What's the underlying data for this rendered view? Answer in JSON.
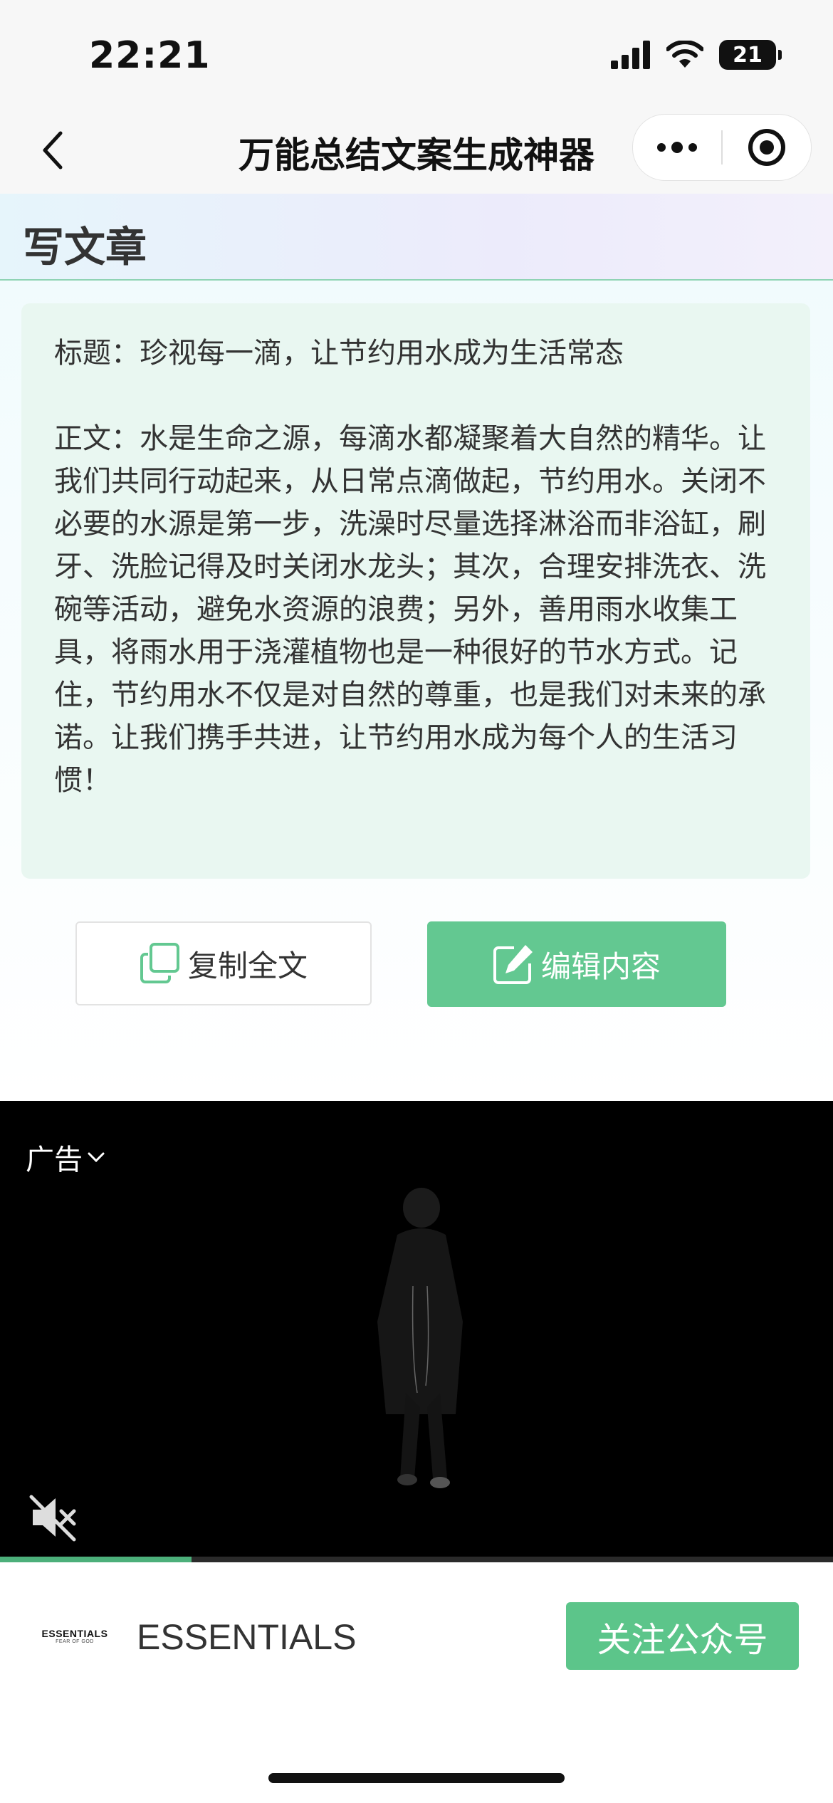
{
  "status_bar": {
    "time": "22:21",
    "battery": "21"
  },
  "nav": {
    "title": "万能总结文案生成神器"
  },
  "header": {
    "heading": "写文章"
  },
  "article": {
    "title": "标题：珍视每一滴，让节约用水成为生活常态",
    "body": "正文：水是生命之源，每滴水都凝聚着大自然的精华。让我们共同行动起来，从日常点滴做起，节约用水。关闭不必要的水源是第一步，洗澡时尽量选择淋浴而非浴缸，刷牙、洗脸记得及时关闭水龙头；其次，合理安排洗衣、洗碗等活动，避免水资源的浪费；另外，善用雨水收集工具，将雨水用于浇灌植物也是一种很好的节水方式。记住，节约用水不仅是对自然的尊重，也是我们对未来的承诺。让我们携手共进，让节约用水成为每个人的生活习惯！"
  },
  "actions": {
    "copy_label": "复制全文",
    "edit_label": "编辑内容"
  },
  "ad": {
    "label": "广告",
    "progress_fraction": 0.23,
    "brand_logo_text": "ESSENTIALS",
    "brand_logo_sub": "FEAR OF GOD",
    "brand_name": "ESSENTIALS",
    "follow_label": "关注公众号"
  },
  "colors": {
    "accent": "#63c891",
    "card_bg": "#e9f7f1",
    "nav_bg": "#f7f7f7"
  }
}
